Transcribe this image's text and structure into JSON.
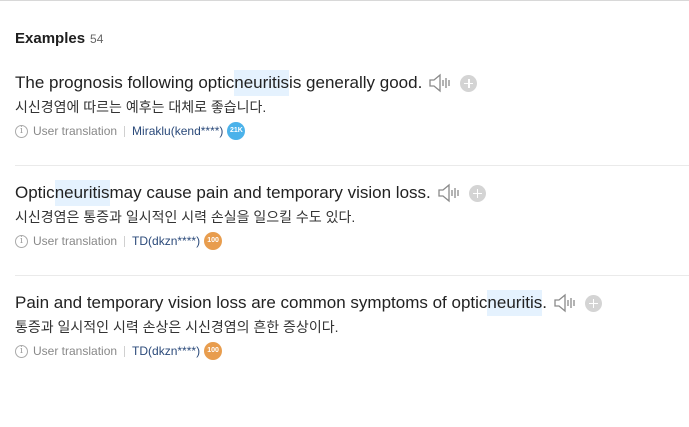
{
  "header": {
    "title": "Examples",
    "count": "54"
  },
  "examples": [
    {
      "sentence": {
        "before": "The prognosis following optic ",
        "highlight": "neuritis",
        "after": " is generally good."
      },
      "translation": "시신경염에 따르는 예후는 대체로 좋습니다.",
      "source_label": "User translation",
      "author": "Miraklu(kend****)",
      "badge": {
        "text": "21K",
        "color": "#4bb2ea"
      }
    },
    {
      "sentence": {
        "before": "Optic ",
        "highlight": "neuritis",
        "after": " may cause pain and temporary vision loss."
      },
      "translation": "시신경염은 통증과 일시적인 시력 손실을 일으킬 수도 있다.",
      "source_label": "User translation",
      "author": "TD(dkzn****)",
      "badge": {
        "text": "100",
        "color": "#e89d4e"
      }
    },
    {
      "sentence": {
        "before": "Pain and temporary vision loss are common symptoms of optic ",
        "highlight": "neuritis",
        "after": "."
      },
      "translation": "통증과 일시적인 시력 손상은 시신경염의 흔한 증상이다.",
      "source_label": "User translation",
      "author": "TD(dkzn****)",
      "badge": {
        "text": "100",
        "color": "#e89d4e"
      }
    }
  ],
  "icons": {
    "speaker": "speaker-icon",
    "add": "plus-icon",
    "info": "info-icon"
  }
}
